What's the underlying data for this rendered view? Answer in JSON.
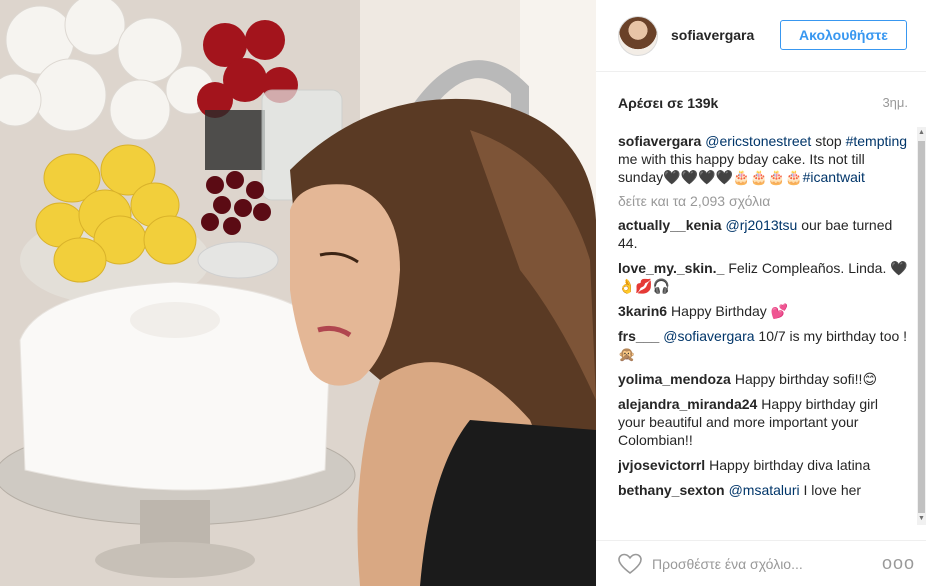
{
  "post": {
    "username": "sofiavergara",
    "follow_label": "Ακολουθήστε",
    "likes": "Αρέσει σε 139k",
    "time": "3ημ.",
    "view_all": "δείτε και τα 2,093 σχόλια",
    "comment_placeholder": "Προσθέστε ένα σχόλιο...",
    "more_label": "ooo"
  },
  "caption": {
    "user": "sofiavergara",
    "mention": "@ericstonestreet",
    "t1": " stop ",
    "hashtag1": "#tempting",
    "t2": " me with this happy bday cake. Its not till sunday🖤🖤🖤🖤🎂🎂🎂🎂",
    "hashtag2": "#icantwait"
  },
  "comments": [
    {
      "user": "actually__kenia",
      "mention": "@rj2013tsu",
      "text": " our bae turned 44."
    },
    {
      "user": "love_my._skin._",
      "mention": "",
      "text": "Feliz Compleaños. Linda. 🖤👌💋🎧"
    },
    {
      "user": "3karin6",
      "mention": "",
      "text": "Happy Birthday 💕"
    },
    {
      "user": "frs___",
      "mention": "@sofiavergara",
      "text": " 10/7 is my birthday too ! 🙊"
    },
    {
      "user": "yolima_mendoza",
      "mention": "",
      "text": "Happy birthday sofi!!😊"
    },
    {
      "user": "alejandra_miranda24",
      "mention": "",
      "text": "Happy birthday girl your beautiful and more important your Colombian!!"
    },
    {
      "user": "jvjosevictorrl",
      "mention": "",
      "text": "Happy birthday diva latina"
    },
    {
      "user": "bethany_sexton",
      "mention": "@msataluri",
      "text": " I love her"
    }
  ]
}
